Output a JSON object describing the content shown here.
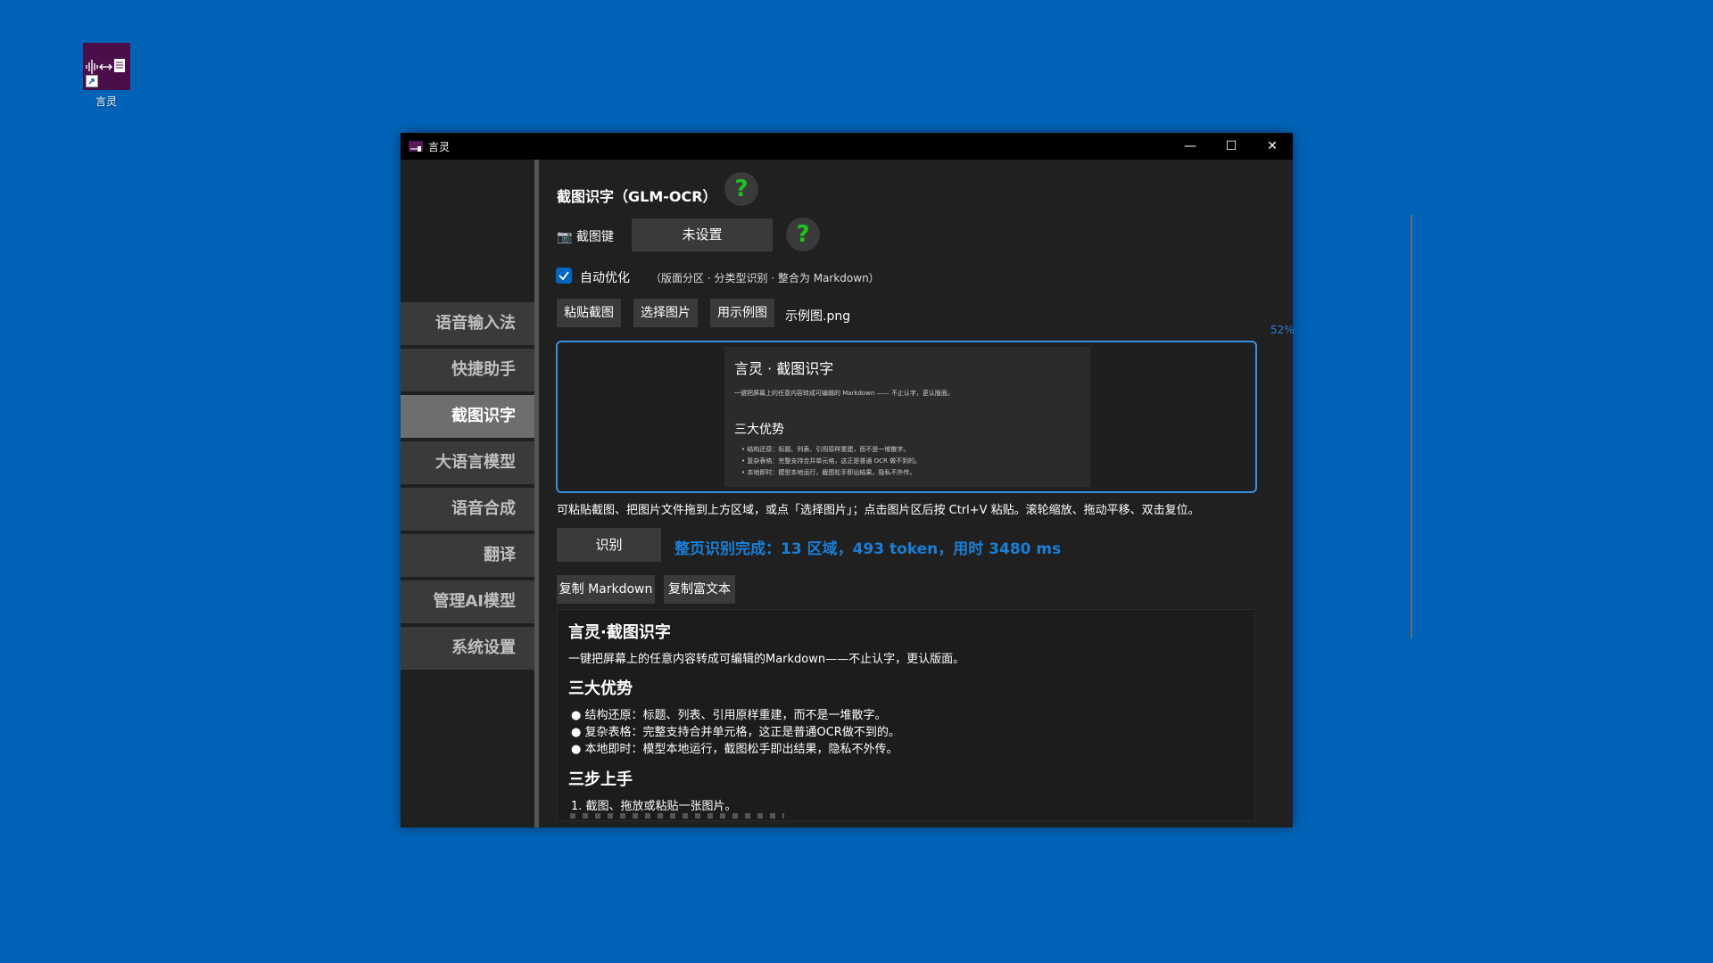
{
  "desktop": {
    "icon_label": "言灵"
  },
  "window": {
    "title": "言灵",
    "controls": {
      "minimize": "—",
      "maximize": "☐",
      "close": "✕"
    }
  },
  "sidebar": {
    "items": [
      {
        "label": "语音输入法",
        "active": false
      },
      {
        "label": "快捷助手",
        "active": false
      },
      {
        "label": "截图识字",
        "active": true
      },
      {
        "label": "大语言模型",
        "active": false
      },
      {
        "label": "语音合成",
        "active": false
      },
      {
        "label": "翻译",
        "active": false
      },
      {
        "label": "管理AI模型",
        "active": false
      },
      {
        "label": "系统设置",
        "active": false
      }
    ]
  },
  "main": {
    "title": "截图识字（GLM-OCR）",
    "help_glyph": "?",
    "hotkey": {
      "icon": "camera-icon",
      "label": "截图键",
      "value": "未设置"
    },
    "auto_opt": {
      "checked": true,
      "label": "自动优化",
      "desc": "（版面分区 · 分类型识别 · 整合为 Markdown）"
    },
    "buttons": {
      "paste": "粘贴截图",
      "choose": "选择图片",
      "sample": "用示例图"
    },
    "filename": "示例图.png",
    "zoom": "52%",
    "preview": {
      "title": "言灵 · 截图识字",
      "subtitle": "一键把屏幕上的任意内容转成可编辑的 Markdown —— 不止认字，更认版面。",
      "h2": "三大优势",
      "items": [
        "结构还原：标题、列表、引用原样重建，而不是一堆散字。",
        "复杂表格：完整支持合并单元格，这正是普通 OCR 做不到的。",
        "本地即时：模型本地运行，截图松手即出结果，隐私不外传。"
      ]
    },
    "hint": "可粘贴截图、把图片文件拖到上方区域，或点「选择图片」；点击图片区后按 Ctrl+V 粘贴。滚轮缩放、拖动平移、双击复位。",
    "recognize_label": "识别",
    "status": "整页识别完成：13 区域，493 token，用时 3480 ms",
    "copy_md": "复制 Markdown",
    "copy_rich": "复制富文本",
    "result": {
      "h1": "言灵·截图识字",
      "p": "一键把屏幕上的任意内容转成可编辑的Markdown——不止认字，更认版面。",
      "h2a": "三大优势",
      "items": [
        "● 结构还原：标题、列表、引用原样重建，而不是一堆散字。",
        "● 复杂表格：完整支持合并单元格，这正是普通OCR做不到的。",
        "● 本地即时：模型本地运行，截图松手即出结果，隐私不外传。"
      ],
      "h2b": "三步上手",
      "step1": "1. 截图、拖放或粘贴一张图片。"
    }
  }
}
